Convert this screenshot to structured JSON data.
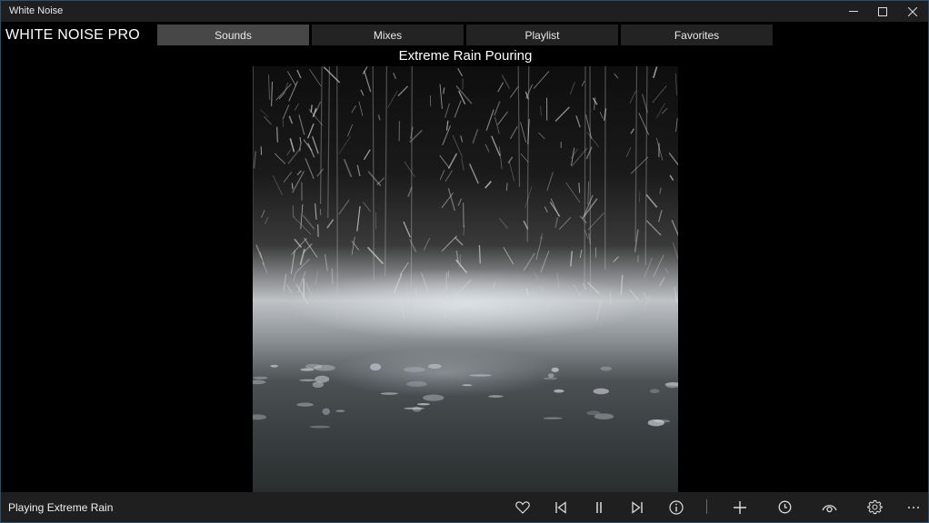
{
  "window": {
    "title": "White Noise",
    "controls": {
      "minimize": "minimize-icon",
      "maximize": "maximize-icon",
      "close": "close-icon"
    }
  },
  "header": {
    "app_name": "WHITE NOISE PRO",
    "tabs": [
      {
        "label": "Sounds",
        "active": true
      },
      {
        "label": "Mixes",
        "active": false
      },
      {
        "label": "Playlist",
        "active": false
      },
      {
        "label": "Favorites",
        "active": false
      }
    ]
  },
  "main": {
    "sound_title": "Extreme Rain Pouring",
    "artwork": "rain-splashing-on-ground-photo"
  },
  "bottom_bar": {
    "status": "Playing Extreme Rain",
    "controls": [
      {
        "name": "favorite",
        "icon": "heart-icon"
      },
      {
        "name": "previous",
        "icon": "skip-previous-icon"
      },
      {
        "name": "pause",
        "icon": "pause-icon"
      },
      {
        "name": "next",
        "icon": "skip-next-icon"
      },
      {
        "name": "info",
        "icon": "info-icon"
      },
      {
        "name": "add",
        "icon": "plus-icon"
      },
      {
        "name": "timer",
        "icon": "clock-icon"
      },
      {
        "name": "view",
        "icon": "eye-icon"
      },
      {
        "name": "settings",
        "icon": "gear-icon"
      },
      {
        "name": "more",
        "icon": "more-icon"
      }
    ]
  },
  "colors": {
    "titlebar_bg": "#1f1f1f",
    "tab_bg": "#232323",
    "tab_active_bg": "#474747",
    "window_border": "#2a4f70"
  }
}
